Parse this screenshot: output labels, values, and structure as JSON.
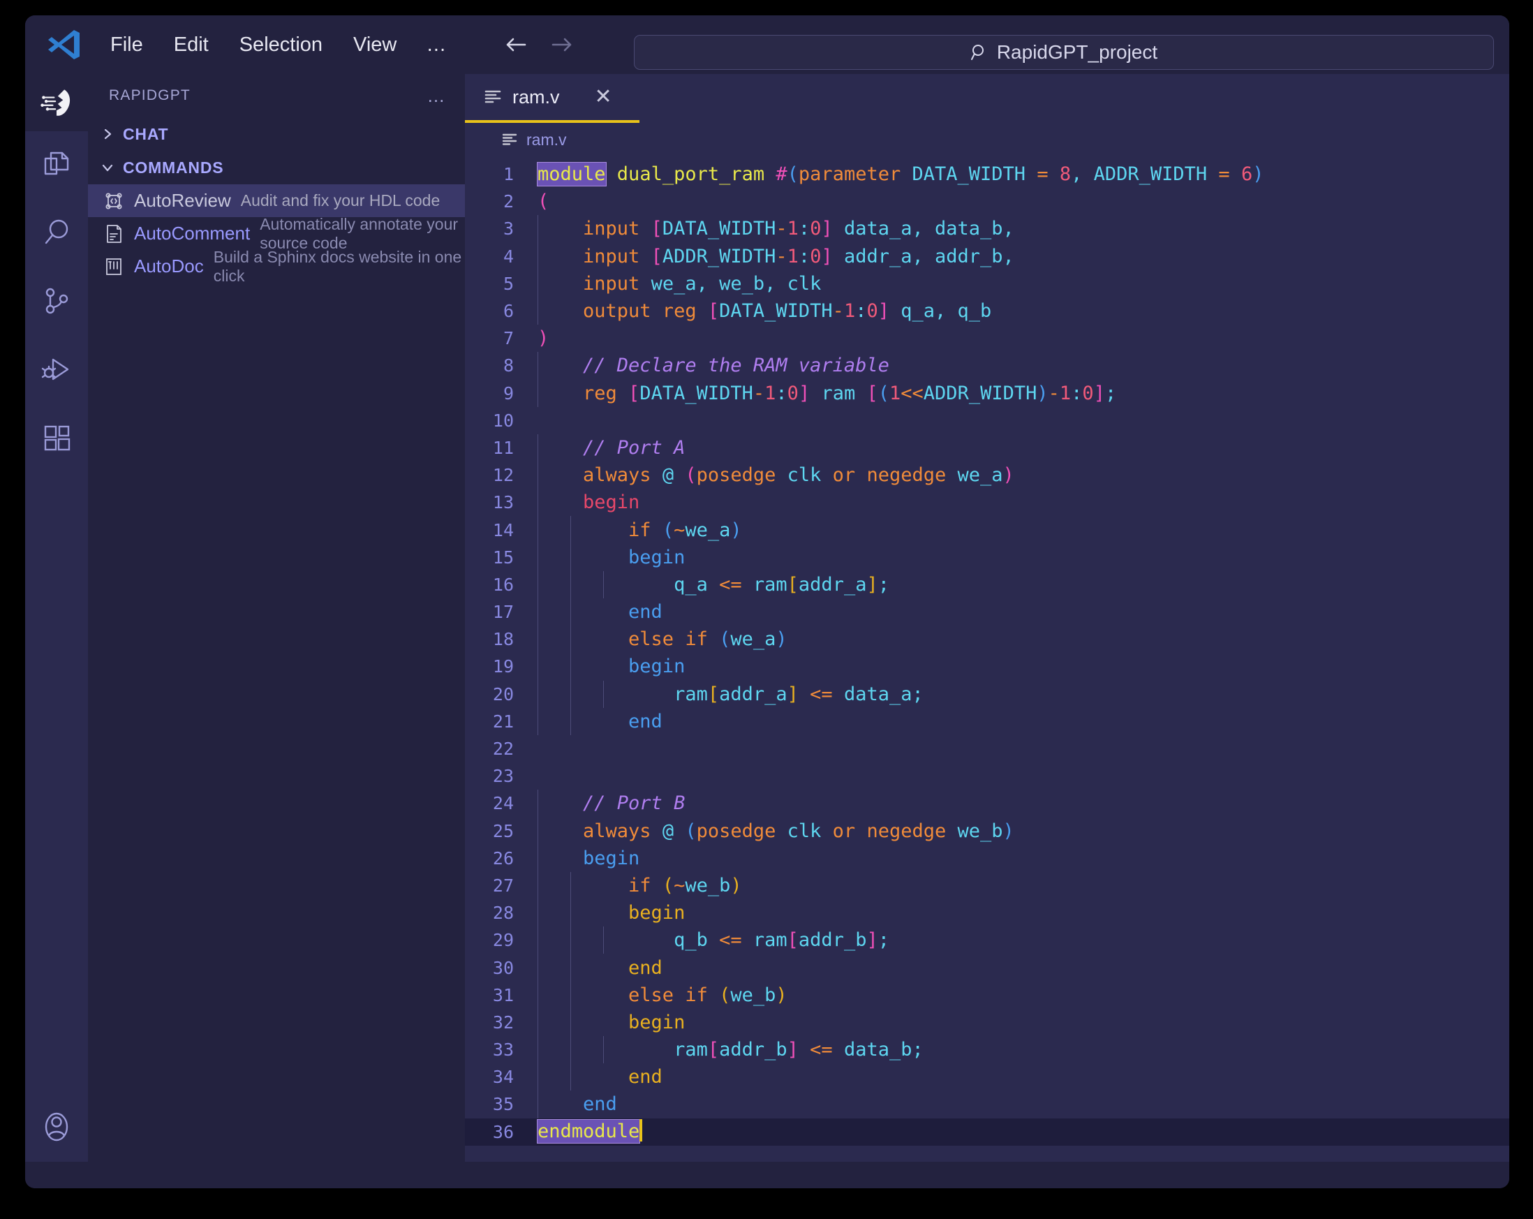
{
  "window": {
    "app": "Visual Studio Code"
  },
  "titlebar": {
    "logo_icon": "vscode-logo-icon",
    "menu": [
      {
        "label": "File"
      },
      {
        "label": "Edit"
      },
      {
        "label": "Selection"
      },
      {
        "label": "View"
      },
      {
        "label": "…"
      }
    ],
    "back_icon": "arrow-left-icon",
    "forward_icon": "arrow-right-icon",
    "quickbar": {
      "search_icon": "search-icon",
      "value": "RapidGPT_project"
    }
  },
  "activitybar": {
    "brand_icon": "rapidgpt-logo-icon",
    "items": [
      {
        "name": "explorer",
        "icon": "files-icon"
      },
      {
        "name": "search",
        "icon": "search-icon"
      },
      {
        "name": "source-control",
        "icon": "source-control-icon"
      },
      {
        "name": "run-and-debug",
        "icon": "run-debug-icon"
      },
      {
        "name": "extensions",
        "icon": "extensions-icon"
      }
    ],
    "bottom": [
      {
        "name": "accounts",
        "icon": "account-icon"
      }
    ]
  },
  "sidebar": {
    "title": "RAPIDGPT",
    "more_actions_icon": "ellipsis-icon",
    "sections": [
      {
        "label": "CHAT",
        "expanded": false,
        "chevron": "chevron-right-icon"
      },
      {
        "label": "COMMANDS",
        "expanded": true,
        "chevron": "chevron-down-icon"
      }
    ],
    "commands": [
      {
        "icon": "chip-code-icon",
        "name": "AutoReview",
        "description": "Audit and fix your HDL code",
        "selected": true
      },
      {
        "icon": "document-lines-icon",
        "name": "AutoComment",
        "description": "Automatically annotate your source code",
        "selected": false
      },
      {
        "icon": "book-layout-icon",
        "name": "AutoDoc",
        "description": "Build a Sphinx docs website in one click",
        "selected": false
      }
    ]
  },
  "editor": {
    "tab": {
      "file_icon": "verilog-file-icon",
      "label": "ram.v",
      "close_icon": "close-icon",
      "active": true
    },
    "breadcrumb": {
      "icon": "verilog-file-icon",
      "label": "ram.v"
    },
    "current_line": 36,
    "cursor_column": 10,
    "lines": [
      {
        "n": "1",
        "text": "module dual_port_ram #(parameter DATA_WIDTH = 8, ADDR_WIDTH = 6)"
      },
      {
        "n": "2",
        "text": "("
      },
      {
        "n": "3",
        "text": "    input [DATA_WIDTH-1:0] data_a, data_b,"
      },
      {
        "n": "4",
        "text": "    input [ADDR_WIDTH-1:0] addr_a, addr_b,"
      },
      {
        "n": "5",
        "text": "    input we_a, we_b, clk"
      },
      {
        "n": "6",
        "text": "    output reg [DATA_WIDTH-1:0] q_a, q_b"
      },
      {
        "n": "7",
        "text": ")"
      },
      {
        "n": "8",
        "text": "    // Declare the RAM variable"
      },
      {
        "n": "9",
        "text": "    reg [DATA_WIDTH-1:0] ram [(1<<ADDR_WIDTH)-1:0];"
      },
      {
        "n": "10",
        "text": ""
      },
      {
        "n": "11",
        "text": "    // Port A"
      },
      {
        "n": "12",
        "text": "    always @ (posedge clk or negedge we_a)"
      },
      {
        "n": "13",
        "text": "    begin"
      },
      {
        "n": "14",
        "text": "        if (~we_a)"
      },
      {
        "n": "15",
        "text": "        begin"
      },
      {
        "n": "16",
        "text": "            q_a <= ram[addr_a];"
      },
      {
        "n": "17",
        "text": "        end"
      },
      {
        "n": "18",
        "text": "        else if (we_a)"
      },
      {
        "n": "19",
        "text": "        begin"
      },
      {
        "n": "20",
        "text": "            ram[addr_a] <= data_a;"
      },
      {
        "n": "21",
        "text": "        end"
      },
      {
        "n": "22",
        "text": ""
      },
      {
        "n": "23",
        "text": ""
      },
      {
        "n": "24",
        "text": "    // Port B"
      },
      {
        "n": "25",
        "text": "    always @ (posedge clk or negedge we_b)"
      },
      {
        "n": "26",
        "text": "    begin"
      },
      {
        "n": "27",
        "text": "        if (~we_b)"
      },
      {
        "n": "28",
        "text": "        begin"
      },
      {
        "n": "29",
        "text": "            q_b <= ram[addr_b];"
      },
      {
        "n": "30",
        "text": "        end"
      },
      {
        "n": "31",
        "text": "        else if (we_b)"
      },
      {
        "n": "32",
        "text": "        begin"
      },
      {
        "n": "33",
        "text": "            ram[addr_b] <= data_b;"
      },
      {
        "n": "34",
        "text": "        end"
      },
      {
        "n": "35",
        "text": "    end"
      },
      {
        "n": "36",
        "text": "endmodule"
      }
    ]
  },
  "colors": {
    "editor_bg": "#2b2a4f",
    "panel_bg": "#23223f",
    "current_line_bg": "#1e1d3c",
    "selected_row_bg": "#3a3869",
    "tab_accent": "#e8c21a",
    "line_number": "#8888e0",
    "keyword_yellow": "#e8e84a",
    "keyword_orange": "#f08b3a",
    "identifier_cyan": "#5ed6f0",
    "comment_purple": "#b07ef0",
    "number_pink": "#f05a7a",
    "bracket_magenta": "#f050b8",
    "bracket_blue": "#4a9ef0",
    "begin_red": "#e8486a",
    "begin_gold": "#e8b020",
    "bracket_match_bg": "#6a52b5"
  }
}
